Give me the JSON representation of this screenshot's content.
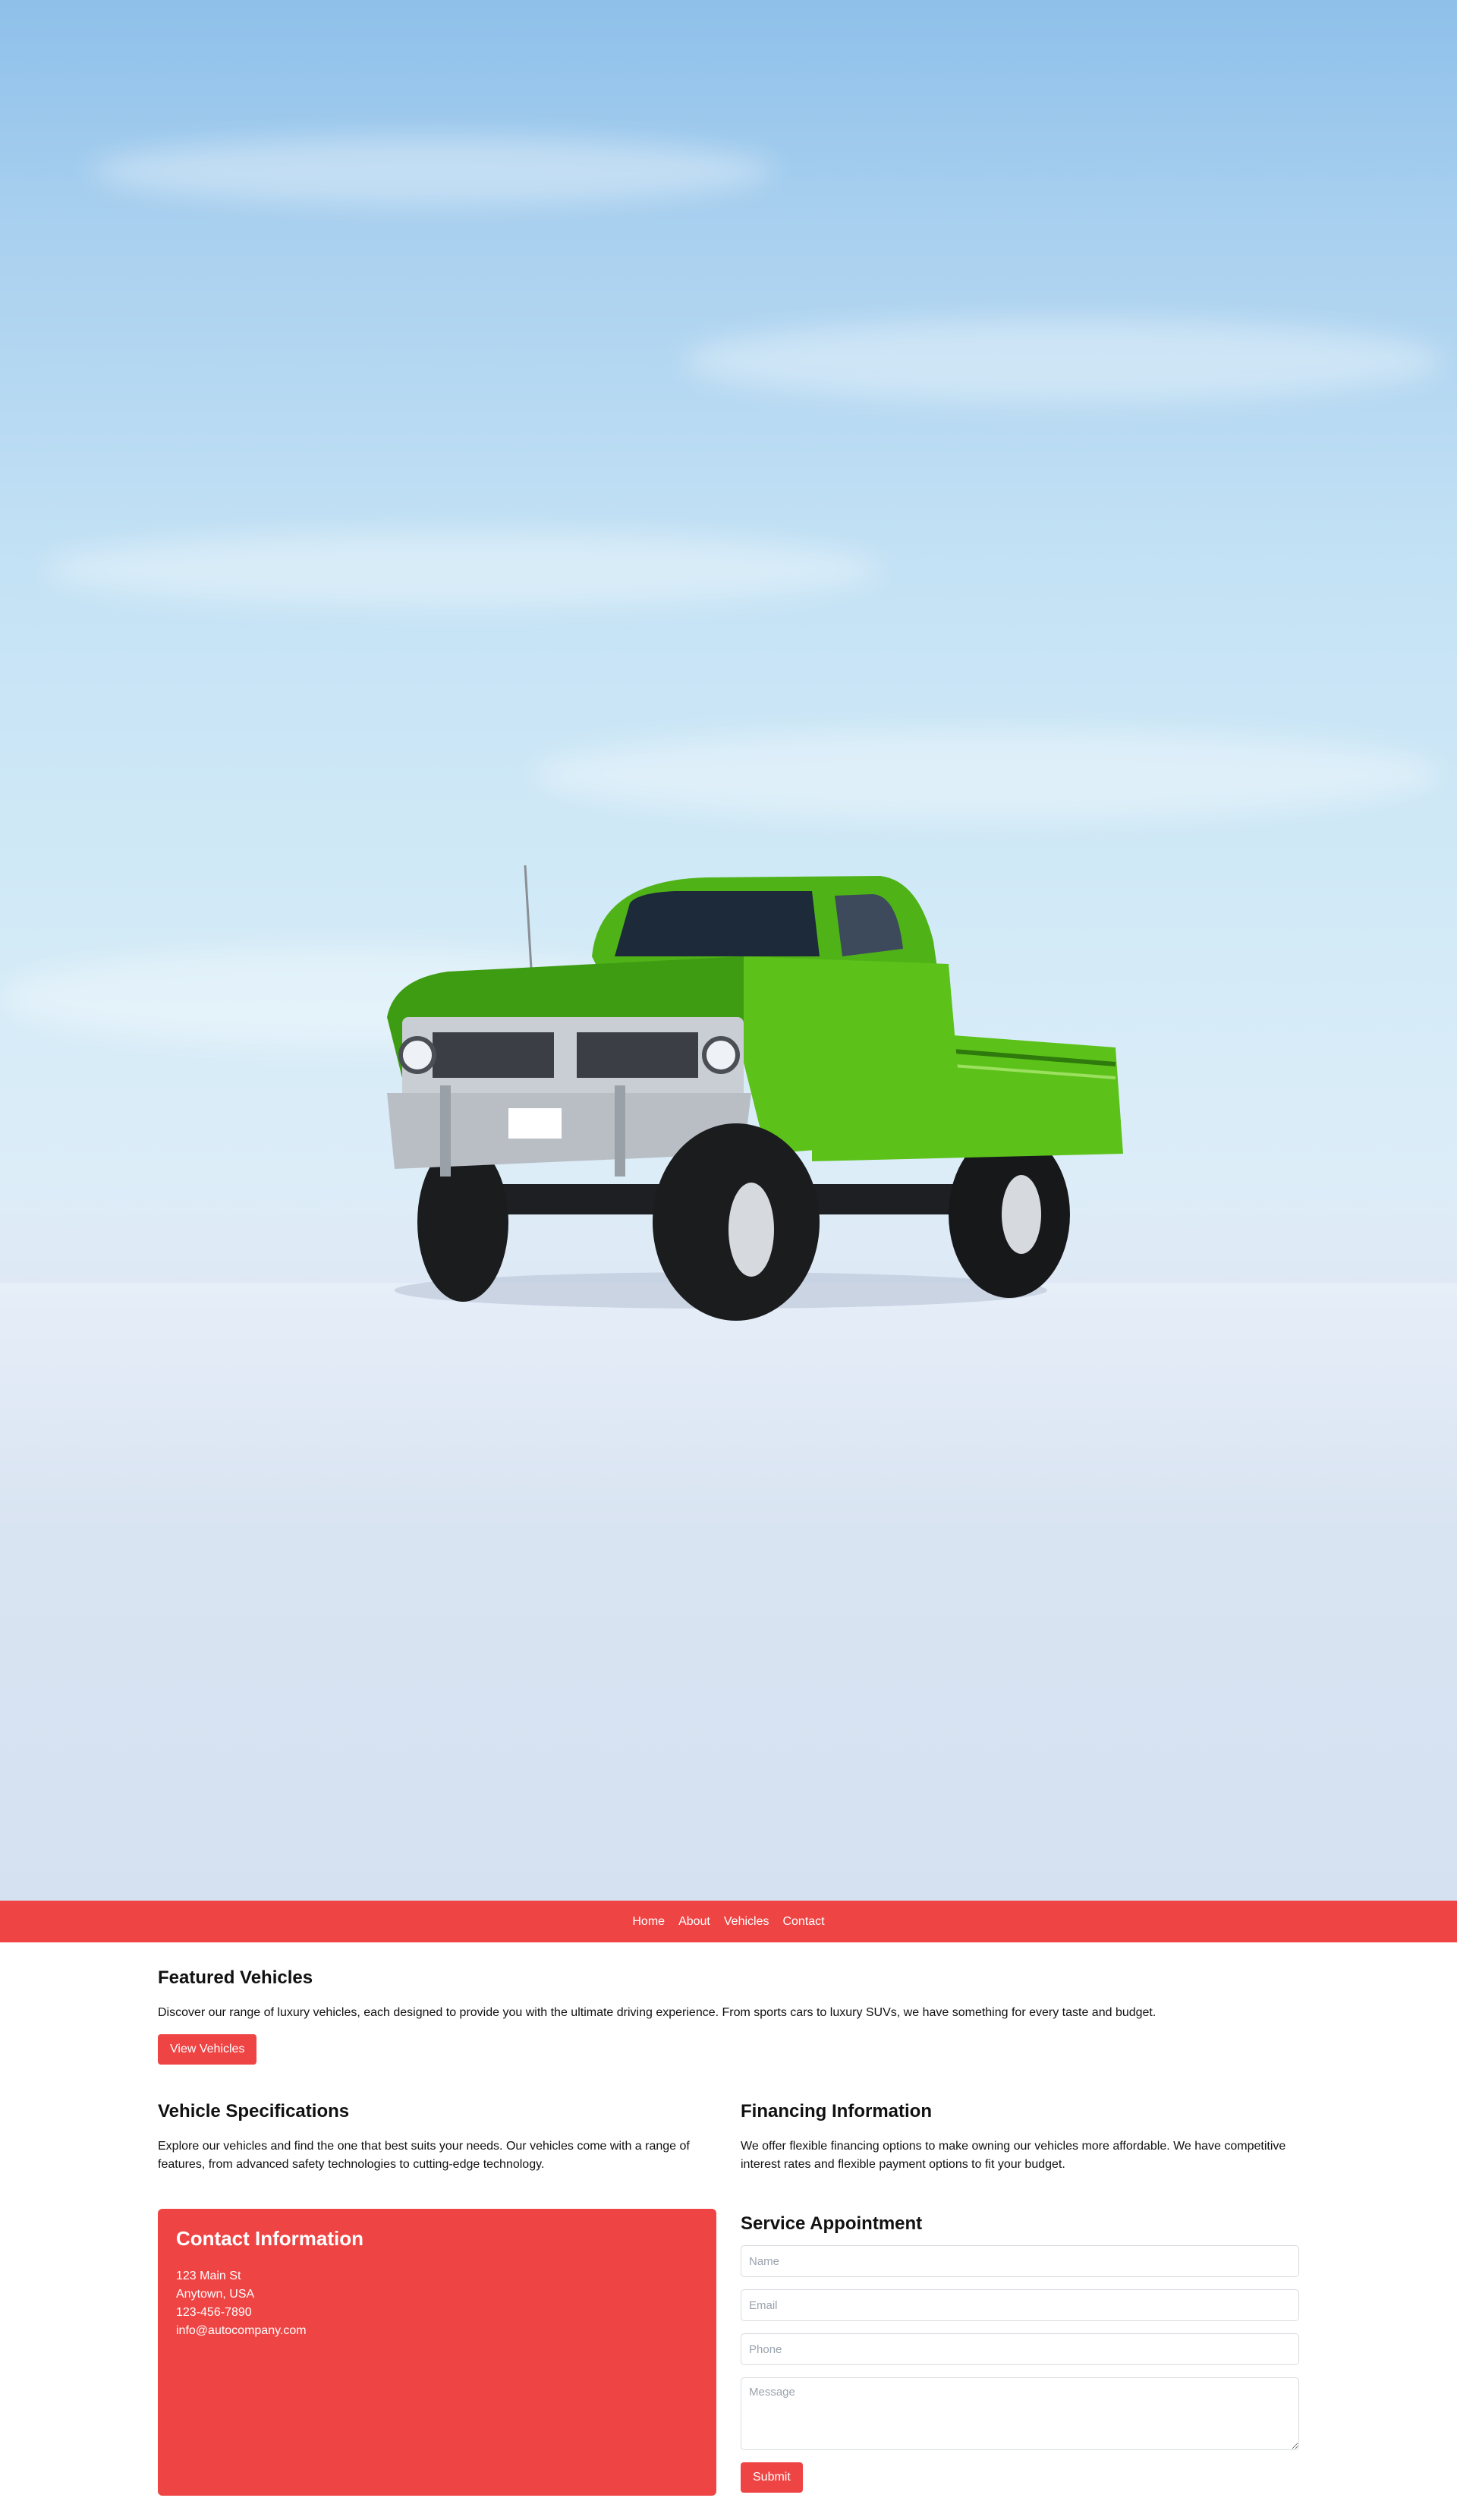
{
  "hero": {
    "image": "green lifted pickup truck on snow under blue sky"
  },
  "nav": {
    "items": [
      "Home",
      "About",
      "Vehicles",
      "Contact"
    ]
  },
  "featured": {
    "title": "Featured Vehicles",
    "text": "Discover our range of luxury vehicles, each designed to provide you with the ultimate driving experience. From sports cars to luxury SUVs, we have something for every taste and budget.",
    "button": "View Vehicles"
  },
  "specs": {
    "title": "Vehicle Specifications",
    "text": "Explore our vehicles and find the one that best suits your needs. Our vehicles come with a range of features, from advanced safety technologies to cutting-edge technology."
  },
  "financing": {
    "title": "Financing Information",
    "text": "We offer flexible financing options to make owning our vehicles more affordable. We have competitive interest rates and flexible payment options to fit your budget."
  },
  "contact": {
    "title": "Contact Information",
    "lines": [
      "123 Main St",
      "Anytown, USA",
      "123-456-7890",
      "info@autocompany.com"
    ]
  },
  "service": {
    "title": "Service Appointment",
    "placeholders": {
      "name": "Name",
      "email": "Email",
      "phone": "Phone",
      "message": "Message"
    },
    "submit": "Submit"
  },
  "colors": {
    "accent": "#ef4444",
    "sky": "#a9d0ef",
    "truck": "#5cc21a"
  }
}
